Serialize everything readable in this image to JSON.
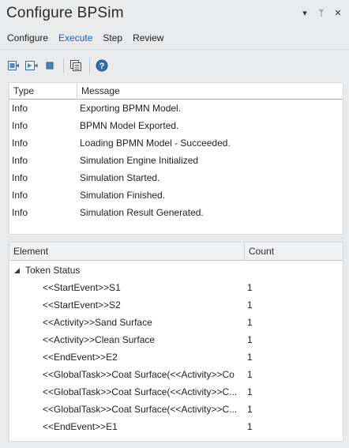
{
  "window": {
    "title": "Configure BPSim",
    "controls": [
      {
        "name": "dropdown",
        "glyph": "▾"
      },
      {
        "name": "pin",
        "glyph": "ᛘ"
      },
      {
        "name": "close",
        "glyph": "✕"
      }
    ]
  },
  "tabs": [
    {
      "label": "Configure",
      "active": false
    },
    {
      "label": "Execute",
      "active": true
    },
    {
      "label": "Step",
      "active": false
    },
    {
      "label": "Review",
      "active": false
    }
  ],
  "toolbar": {
    "buttons": [
      "run-simulation-icon",
      "run-step-icon",
      "stop-icon",
      "results-icon",
      "help-icon"
    ]
  },
  "messages": {
    "columns": {
      "type": "Type",
      "message": "Message"
    },
    "rows": [
      {
        "type": "Info",
        "message": "Exporting BPMN Model."
      },
      {
        "type": "Info",
        "message": "BPMN Model Exported."
      },
      {
        "type": "Info",
        "message": "Loading BPMN Model - Succeeded."
      },
      {
        "type": "Info",
        "message": "Simulation Engine Initialized"
      },
      {
        "type": "Info",
        "message": "Simulation Started."
      },
      {
        "type": "Info",
        "message": "Simulation Finished."
      },
      {
        "type": "Info",
        "message": "Simulation Result Generated."
      }
    ]
  },
  "elements": {
    "columns": {
      "element": "Element",
      "count": "Count"
    },
    "group": "Token Status",
    "rows": [
      {
        "element": "<<StartEvent>>S1",
        "count": "1"
      },
      {
        "element": "<<StartEvent>>S2",
        "count": "1"
      },
      {
        "element": "<<Activity>>Sand Surface",
        "count": "1"
      },
      {
        "element": "<<Activity>>Clean Surface",
        "count": "1"
      },
      {
        "element": "<<EndEvent>>E2",
        "count": "1"
      },
      {
        "element": "<<GlobalTask>>Coat Surface(<<Activity>>Co",
        "count": "1"
      },
      {
        "element": "<<GlobalTask>>Coat Surface(<<Activity>>C...",
        "count": "1"
      },
      {
        "element": "<<GlobalTask>>Coat Surface(<<Activity>>C...",
        "count": "1"
      },
      {
        "element": "<<EndEvent>>E1",
        "count": "1"
      }
    ]
  }
}
